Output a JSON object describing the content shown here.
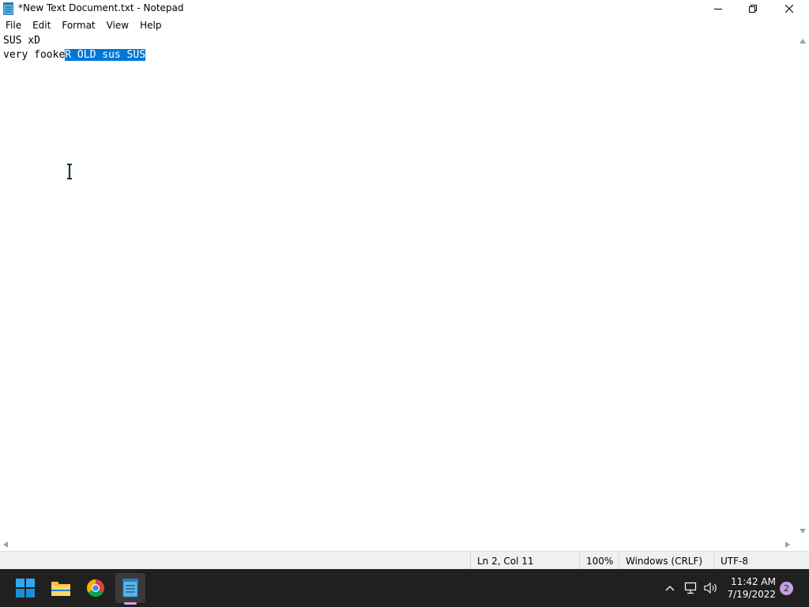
{
  "window": {
    "title": "*New Text Document.txt - Notepad"
  },
  "menu": {
    "items": [
      "File",
      "Edit",
      "Format",
      "View",
      "Help"
    ]
  },
  "editor": {
    "lines": [
      {
        "text": "SUS xD",
        "selected": ""
      },
      {
        "text": "very fooke",
        "selected": "R OLD sus SUS"
      }
    ],
    "selection_color": "#0078d7"
  },
  "statusbar": {
    "position": "Ln 2, Col 11",
    "zoom": "100%",
    "line_ending": "Windows (CRLF)",
    "encoding": "UTF-8"
  },
  "taskbar": {
    "apps": [
      "start-icon",
      "file-explorer-icon",
      "chrome-icon",
      "notepad-icon"
    ],
    "time": "11:42 AM",
    "date": "7/19/2022",
    "notification_count": "2"
  }
}
